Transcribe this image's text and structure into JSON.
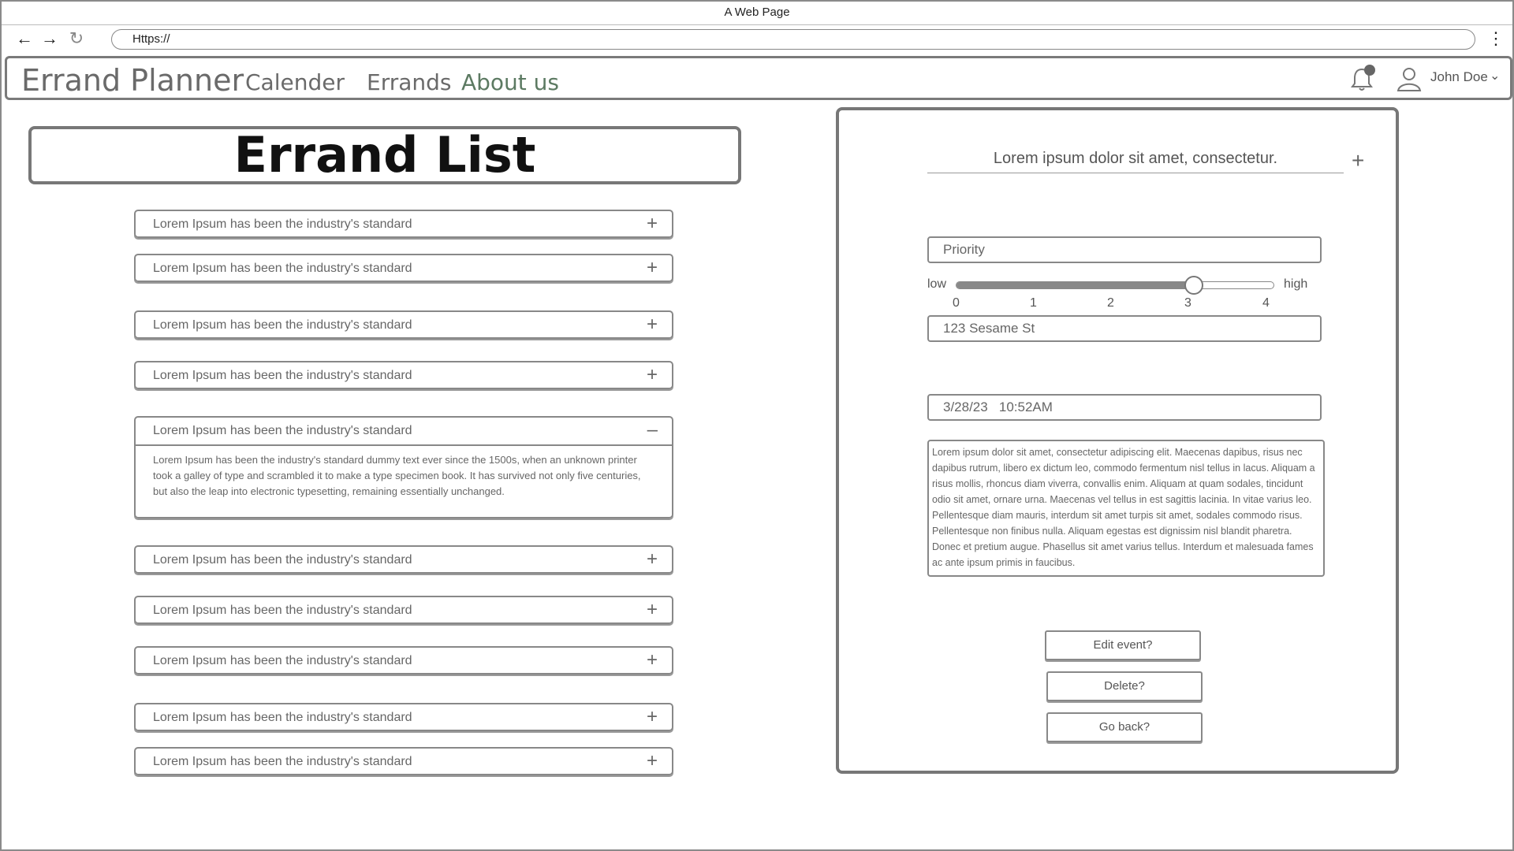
{
  "browser": {
    "window_title": "A Web Page",
    "url": "Https://"
  },
  "appbar": {
    "brand": "Errand Planner",
    "nav": [
      {
        "label": "Calender",
        "active": false
      },
      {
        "label": "Errands",
        "active": false
      },
      {
        "label": "About us",
        "active": true
      }
    ],
    "username": "John Doe"
  },
  "errand_list": {
    "title": "Errand List",
    "items": [
      {
        "label": "Lorem Ipsum has been the industry's standard",
        "expanded": false
      },
      {
        "label": "Lorem Ipsum has been the industry's standard",
        "expanded": false
      },
      {
        "label": "Lorem Ipsum has been the industry's standard",
        "expanded": false
      },
      {
        "label": "Lorem Ipsum has been the industry's standard",
        "expanded": false
      },
      {
        "label": "Lorem Ipsum has been the industry's standard",
        "expanded": true,
        "body": "Lorem Ipsum has been the industry's standard dummy text ever since the 1500s, when an unknown printer took a galley of type and scrambled it to make a type specimen book. It has survived not only five centuries, but also the leap into electronic typesetting, remaining essentially unchanged."
      },
      {
        "label": "Lorem Ipsum has been the industry's standard",
        "expanded": false
      },
      {
        "label": "Lorem Ipsum has been the industry's standard",
        "expanded": false
      },
      {
        "label": "Lorem Ipsum has been the industry's standard",
        "expanded": false
      },
      {
        "label": "Lorem Ipsum has been the industry's standard",
        "expanded": false
      },
      {
        "label": "Lorem Ipsum has been the industry's standard",
        "expanded": false
      }
    ]
  },
  "detail": {
    "title": "Lorem ipsum dolor sit amet, consectetur.",
    "priority_label": "Priority",
    "priority": {
      "low_label": "low",
      "high_label": "high",
      "ticks": [
        "0",
        "1",
        "2",
        "3",
        "4"
      ],
      "value": 3,
      "max": 4
    },
    "address": "123 Sesame St",
    "datetime": "3/28/23   10:52AM",
    "description": "Lorem ipsum dolor sit amet, consectetur adipiscing elit. Maecenas dapibus, risus nec dapibus rutrum, libero ex dictum leo, commodo fermentum nisl tellus in lacus. Aliquam a risus mollis, rhoncus diam viverra, convallis enim. Aliquam at quam sodales, tincidunt odio sit amet, ornare urna. Maecenas vel tellus in est sagittis lacinia. In vitae varius leo. Pellentesque diam mauris, interdum sit amet turpis sit amet, sodales commodo risus. Pellentesque non finibus nulla. Aliquam egestas est dignissim nisl blandit pharetra. Donec et pretium augue. Phasellus sit amet varius tellus. Interdum et malesuada fames ac ante ipsum primis in faucibus.",
    "buttons": {
      "edit": "Edit event?",
      "delete": "Delete?",
      "back": "Go back?"
    }
  }
}
